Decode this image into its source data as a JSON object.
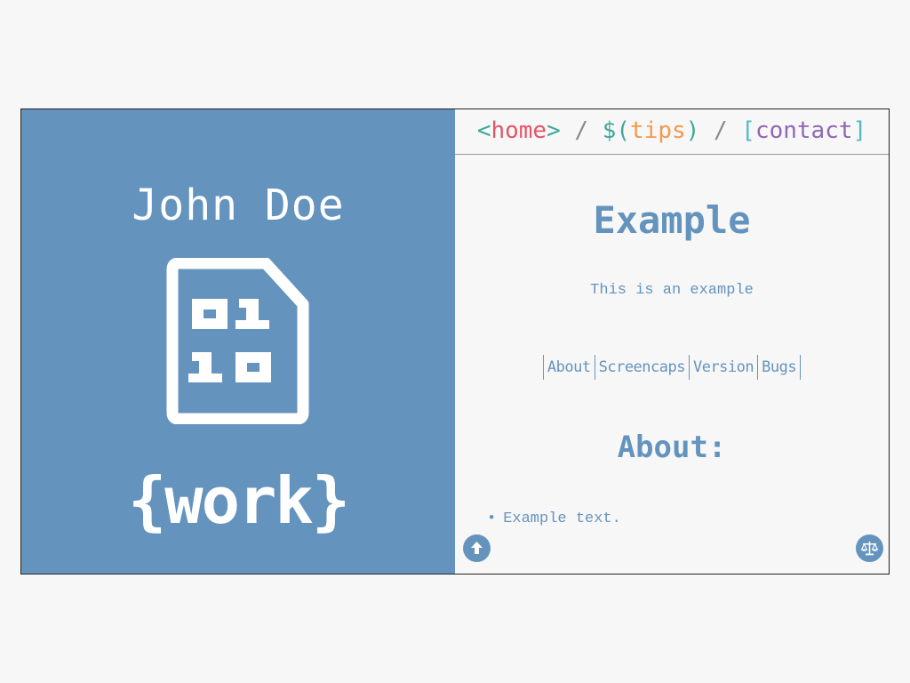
{
  "sidebar": {
    "author_name": "John Doe",
    "icon": "binary-file-icon",
    "work_label": "{work}"
  },
  "nav": {
    "home": {
      "open": "<",
      "label": "home",
      "close": ">"
    },
    "sep1": " / ",
    "tips": {
      "open": "$(",
      "label": "tips",
      "close": ")"
    },
    "sep2": " / ",
    "contact": {
      "open": "[",
      "label": "contact",
      "close": "]"
    }
  },
  "main": {
    "title": "Example",
    "subtitle": "This is an example",
    "links": [
      "About",
      "Screencaps",
      "Version",
      "Bugs"
    ],
    "about_heading": "About:",
    "about_items": [
      "Example text."
    ]
  },
  "buttons": {
    "up_icon": "arrow-up-icon",
    "license_icon": "balance-scale-icon"
  },
  "colors": {
    "accent": "#6494bd",
    "background": "#f7f7f7",
    "nav_teal": "#3fa89a",
    "nav_red": "#e2566a",
    "nav_orange": "#f39a4e",
    "nav_cyan": "#56b8c8",
    "nav_purple": "#9168b4"
  }
}
